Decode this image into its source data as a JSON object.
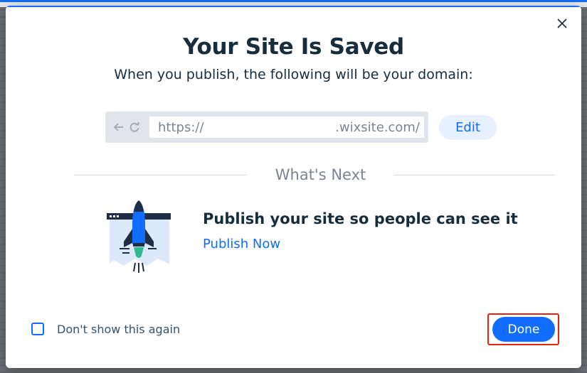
{
  "dialog": {
    "title": "Your Site Is Saved",
    "subtitle": "When you publish, the following will be your domain:",
    "close_icon": "close-icon"
  },
  "domain": {
    "url_prefix": "https://",
    "url_suffix": ".wixsite.com/",
    "edit_label": "Edit"
  },
  "whats_next": {
    "heading": "What's Next",
    "title": "Publish your site so people can see it",
    "link_label": "Publish Now",
    "illustration_icon": "rocket-illustration-icon"
  },
  "footer": {
    "checkbox_label": "Don't show this again",
    "checkbox_checked": false,
    "done_label": "Done"
  },
  "colors": {
    "accent": "#116dff",
    "text_primary": "#162d3d",
    "text_secondary": "#7a8593",
    "highlight": "#e62214"
  }
}
